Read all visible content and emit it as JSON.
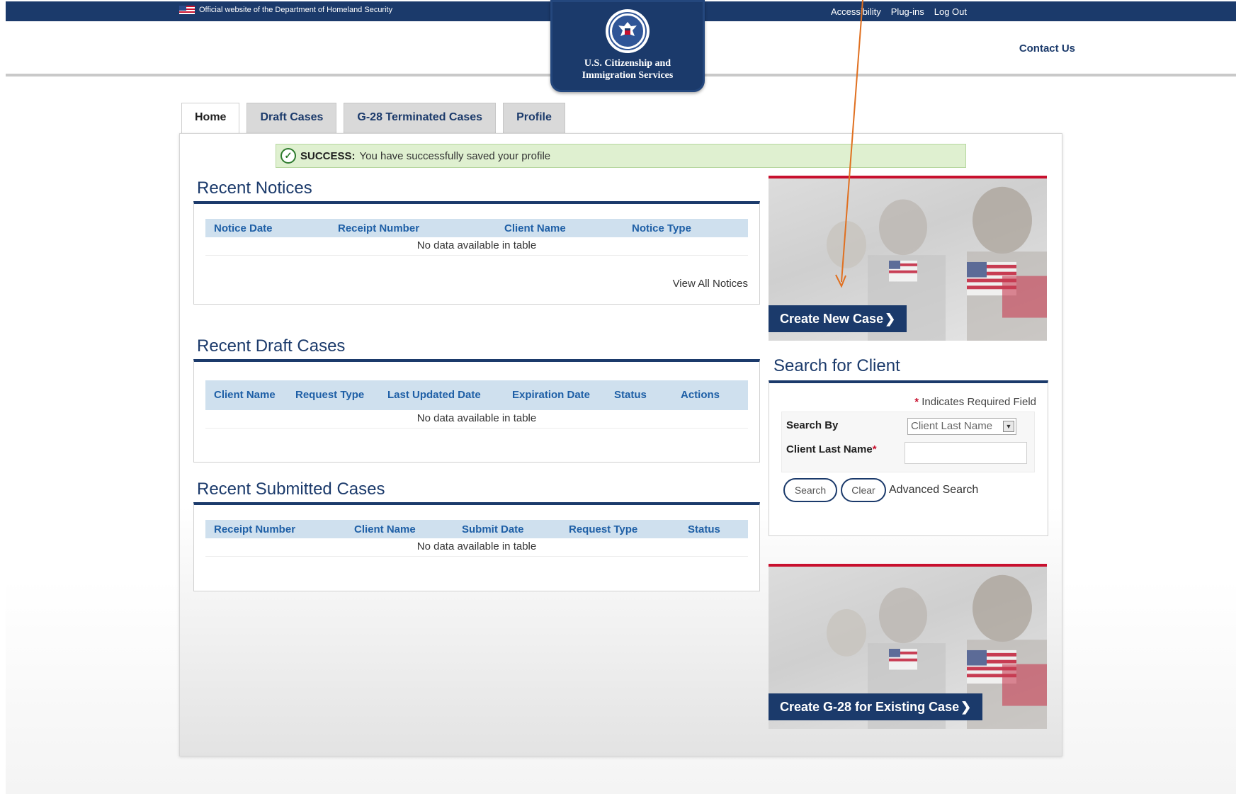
{
  "topbar": {
    "official_text": "Official website of the Department of Homeland Security",
    "links": [
      "Accessibility",
      "Plug-ins",
      "Log Out"
    ]
  },
  "header": {
    "contact": "Contact Us",
    "logo_line1": "U.S. Citizenship and",
    "logo_line2": "Immigration Services"
  },
  "tabs": [
    "Home",
    "Draft Cases",
    "G-28 Terminated Cases",
    "Profile"
  ],
  "active_tab": "Home",
  "success": {
    "label": "SUCCESS:",
    "message": "You have successfully saved your profile"
  },
  "recent_notices": {
    "title": "Recent Notices",
    "columns": [
      "Notice Date",
      "Receipt Number",
      "Client Name",
      "Notice Type"
    ],
    "empty": "No data available in table",
    "view_all": "View All Notices"
  },
  "recent_drafts": {
    "title": "Recent Draft Cases",
    "columns": [
      "Client Name",
      "Request Type",
      "Last Updated Date",
      "Expiration Date",
      "Status",
      "Actions"
    ],
    "empty": "No data available in table"
  },
  "recent_submitted": {
    "title": "Recent Submitted Cases",
    "columns": [
      "Receipt Number",
      "Client Name",
      "Submit Date",
      "Request Type",
      "Status"
    ],
    "empty": "No data available in table"
  },
  "create_case": {
    "label": "Create New Case"
  },
  "search_client": {
    "title": "Search for Client",
    "required_note": "Indicates Required Field",
    "search_by_label": "Search By",
    "search_by_value": "Client Last Name",
    "last_name_label": "Client Last Name",
    "last_name_value": "",
    "search_button": "Search",
    "clear_button": "Clear",
    "advanced": "Advanced Search"
  },
  "create_g28": {
    "label": "Create G-28 for Existing Case"
  },
  "colors": {
    "navy": "#1b3a6b",
    "link_blue": "#1e5fa6",
    "success_bg": "#dff0d0",
    "accent_red": "#c8102e",
    "annotation_arrow": "#e07020"
  },
  "icons": [
    "us-flag-icon",
    "dhs-seal-icon",
    "check-circle-icon",
    "chevron-right-icon",
    "dropdown-arrow-icon"
  ]
}
